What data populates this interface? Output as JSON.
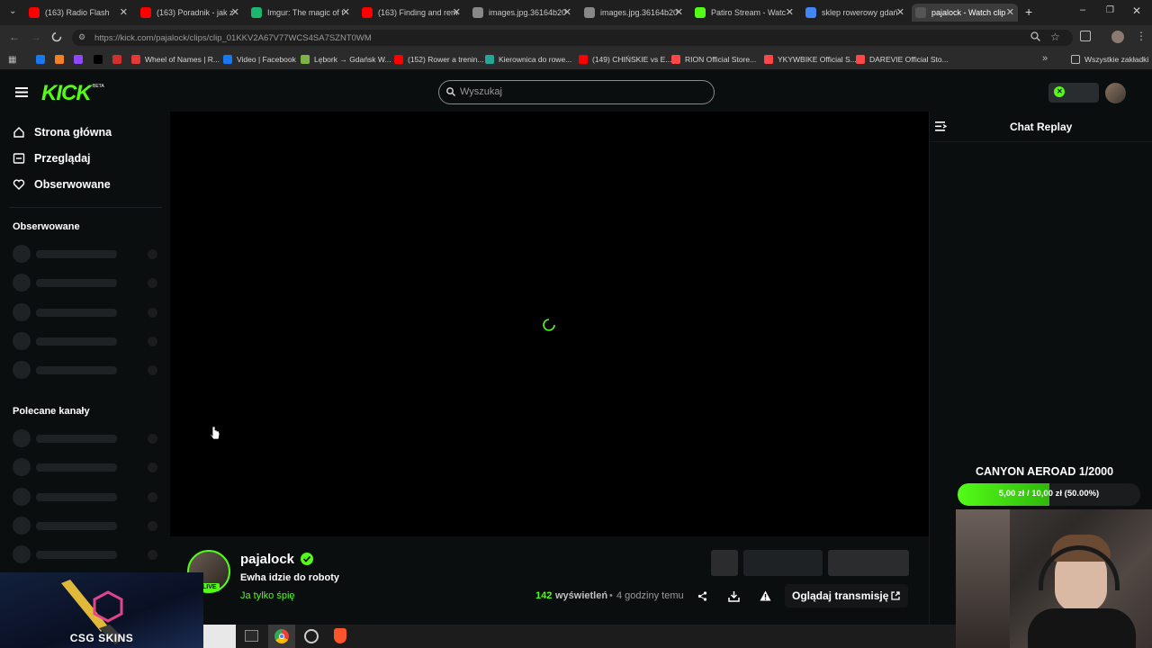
{
  "browser": {
    "tabs": [
      {
        "title": "(163) Radio Flash",
        "fav_color": "#ff0000"
      },
      {
        "title": "(163) Poradnik - jak z",
        "fav_color": "#ff0000"
      },
      {
        "title": "Imgur: The magic of t",
        "fav_color": "#1bb76e"
      },
      {
        "title": "(163) Finding and rem",
        "fav_color": "#ff0000"
      },
      {
        "title": "images.jpg.36164b20",
        "fav_color": "#888888"
      },
      {
        "title": "images.jpg.36164b20",
        "fav_color": "#888888"
      },
      {
        "title": "Patiro Stream - Watc",
        "fav_color": "#53fc18"
      },
      {
        "title": "sklep rowerowy gdań",
        "fav_color": "#4285f4"
      },
      {
        "title": "pajalock - Watch clip",
        "fav_color": "#555555"
      }
    ],
    "new_tab": "+",
    "url": "https://kick.com/pajalock/clips/clip_01KKV2A67V77WCS4SA7SZNT0WM",
    "bookmarks": [
      {
        "label": "",
        "fav_color": "#1877f2"
      },
      {
        "label": "",
        "fav_color": "#f48024"
      },
      {
        "label": "",
        "fav_color": "#9146ff"
      },
      {
        "label": "",
        "fav_color": "#000000"
      },
      {
        "label": "",
        "fav_color": "#d32f2f"
      },
      {
        "label": "Wheel of Names | R...",
        "fav_color": "#e53935"
      },
      {
        "label": "Video | Facebook",
        "fav_color": "#1877f2"
      },
      {
        "label": "Lębork → Gdańsk W...",
        "fav_color": "#7cb342"
      },
      {
        "label": "(152) Rower a trenin...",
        "fav_color": "#ff0000"
      },
      {
        "label": "Kierownica do rowe...",
        "fav_color": "#26a69a"
      },
      {
        "label": "(149) CHIŃSKIE vs E...",
        "fav_color": "#ff0000"
      },
      {
        "label": "RION Official Store...",
        "fav_color": "#ff4747"
      },
      {
        "label": "YKYWBIKE Official S...",
        "fav_color": "#ff4747"
      },
      {
        "label": "DAREVIE Official Sto...",
        "fav_color": "#ff4747"
      }
    ],
    "all_bookmarks": "Wszystkie zakładki"
  },
  "header": {
    "logo": "KICK",
    "logo_tag": "BETA",
    "search_placeholder": "Wyszukaj"
  },
  "sidebar": {
    "nav": [
      {
        "label": "Strona główna",
        "icon": "home-icon"
      },
      {
        "label": "Przeglądaj",
        "icon": "browse-icon"
      },
      {
        "label": "Obserwowane",
        "icon": "heart-icon"
      }
    ],
    "following_title": "Obserwowane",
    "recommended_title": "Polecane kanały"
  },
  "chat": {
    "title": "Chat Replay"
  },
  "clip": {
    "channel": "pajalock",
    "live_badge": "LIVE",
    "title": "Ewha idzie do roboty",
    "category": "Ja tylko śpię",
    "views": "142",
    "views_label": "wyświetleń",
    "time_ago": "4 godziny temu",
    "watch_stream": "Oglądaj transmisję"
  },
  "overlay": {
    "goal_title": "CANYON AEROAD 1/2000",
    "goal_progress": 0.5,
    "goal_text": "5,00 zł / 10,00 zł (50.00%)",
    "csgo_text": "CSG SKINS"
  },
  "colors": {
    "accent": "#53fc18",
    "background": "#0b0e0f"
  }
}
